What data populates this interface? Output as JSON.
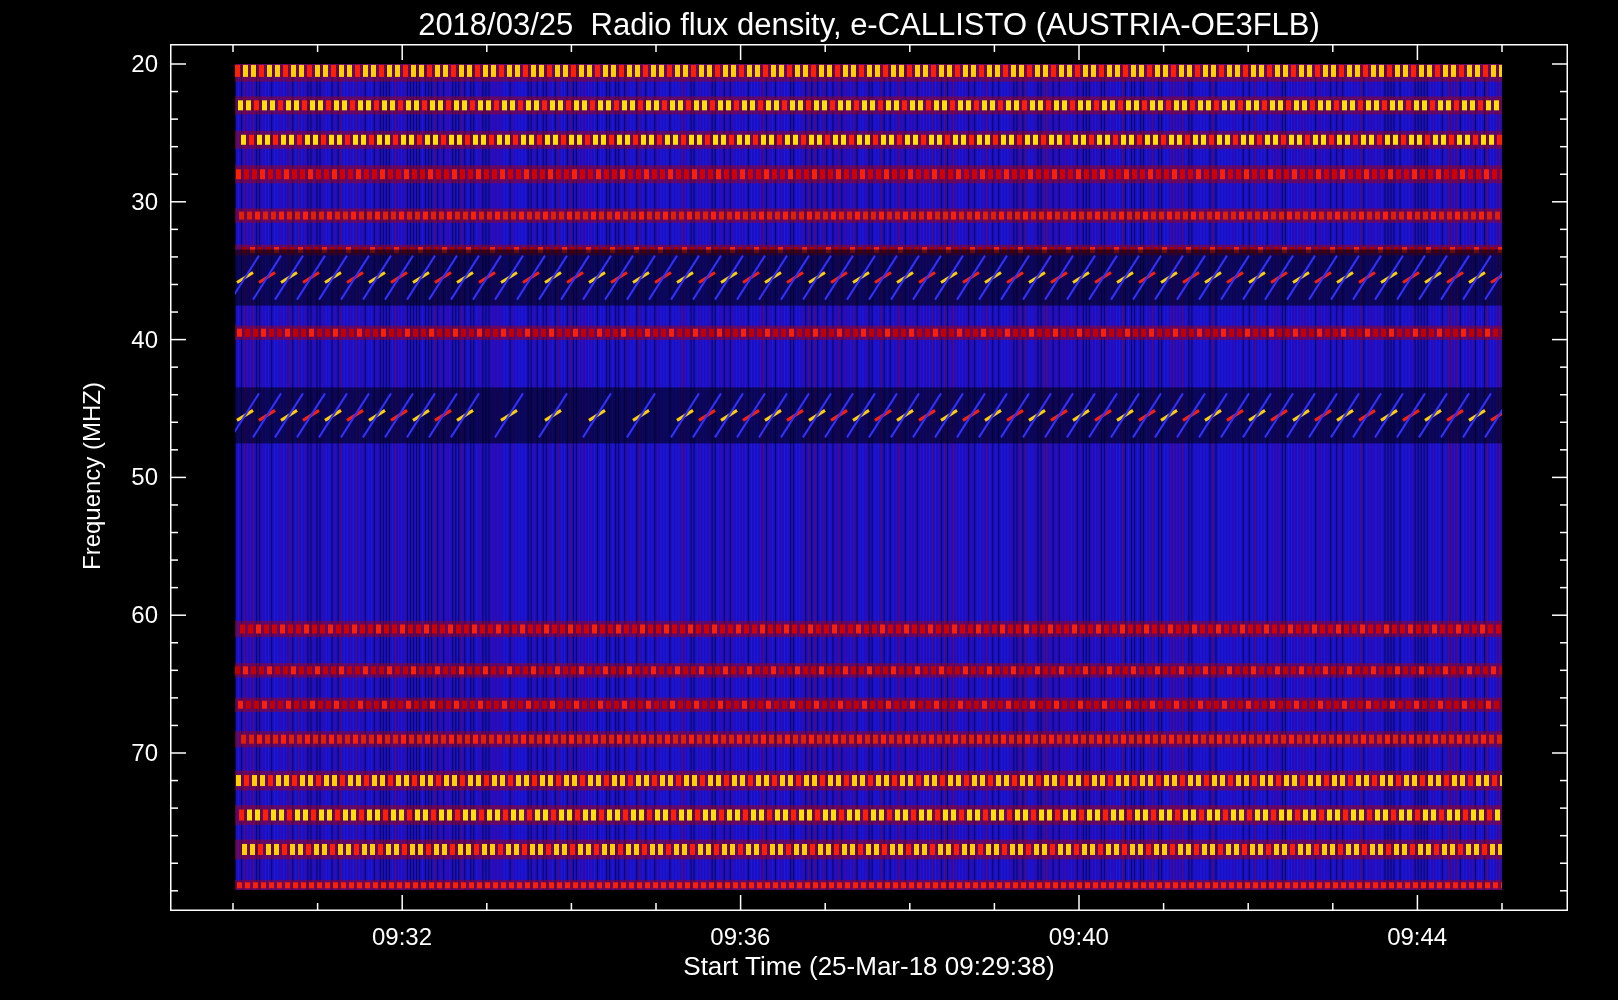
{
  "title": "2018/03/25  Radio flux density, e-CALLISTO (AUSTRIA-OE3FLB)",
  "y_axis": {
    "label": "Frequency (MHZ)",
    "ticks": [
      "20",
      "30",
      "40",
      "50",
      "60",
      "70"
    ]
  },
  "x_axis": {
    "label": "Start Time (25-Mar-18 09:29:38)",
    "ticks": [
      "09:32",
      "09:36",
      "09:40",
      "09:44"
    ]
  }
}
